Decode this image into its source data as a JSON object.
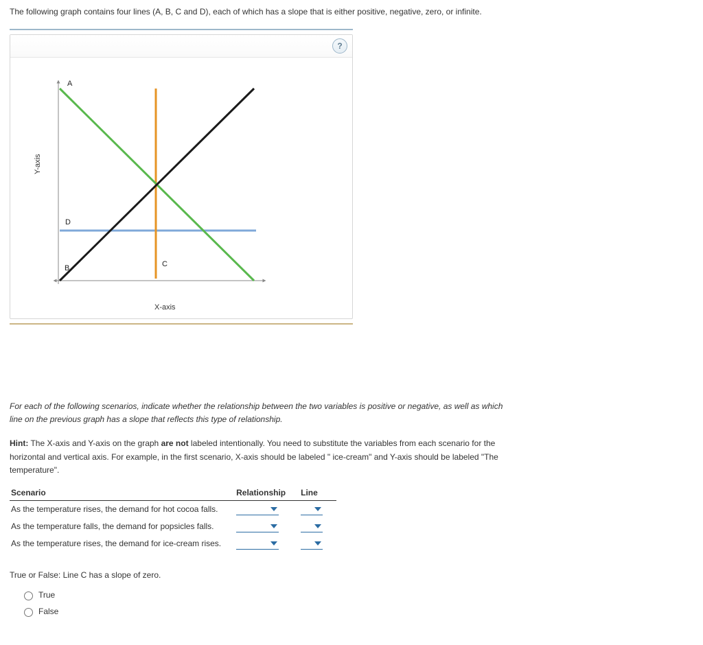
{
  "intro": "The following graph contains four lines (A, B, C and D), each of which has a slope that is either positive, negative, zero, or infinite.",
  "help_glyph": "?",
  "chart": {
    "ylabel": "Y-axis",
    "xlabel": "X-axis",
    "labels": {
      "A": "A",
      "B": "B",
      "C": "C",
      "D": "D"
    }
  },
  "chart_data": {
    "type": "line",
    "title": "",
    "xlabel": "X-axis",
    "ylabel": "Y-axis",
    "xlim": [
      0,
      10
    ],
    "ylim": [
      0,
      10
    ],
    "series": [
      {
        "name": "A",
        "slope": "negative",
        "color": "#59b84d",
        "points": [
          [
            0,
            10
          ],
          [
            10,
            0
          ]
        ]
      },
      {
        "name": "B",
        "slope": "positive",
        "color": "#1a1a1a",
        "points": [
          [
            0,
            0
          ],
          [
            10,
            10
          ]
        ]
      },
      {
        "name": "C",
        "slope": "infinite",
        "color": "#e69425",
        "points": [
          [
            5,
            0
          ],
          [
            5,
            10
          ]
        ]
      },
      {
        "name": "D",
        "slope": "zero",
        "color": "#7fa8d9",
        "points": [
          [
            0,
            3
          ],
          [
            10,
            3
          ]
        ]
      }
    ]
  },
  "prompt_italic": "For each of the following scenarios, indicate whether the relationship between the two variables is positive or negative, as well as which line on the previous graph has a slope that reflects this type of relationship.",
  "hint_label": "Hint:",
  "hint_text_1": " The X-axis and Y-axis on the graph ",
  "hint_bold": "are not",
  "hint_text_2": " labeled intentionally. You need to substitute the variables from each scenario for the horizontal and vertical axis. For example, in the first scenario, X-axis should be labeled \" ice-cream\" and Y-axis should be labeled \"The temperature\".",
  "table": {
    "headers": {
      "scenario": "Scenario",
      "relationship": "Relationship",
      "line": "Line"
    },
    "rows": [
      {
        "scenario": "As the temperature rises, the demand for hot cocoa falls."
      },
      {
        "scenario": "As the temperature falls, the demand for popsicles falls."
      },
      {
        "scenario": "As the temperature rises, the demand for ice-cream rises."
      }
    ]
  },
  "tf_question": "True or False: Line C has a slope of zero.",
  "true_label": "True",
  "false_label": "False"
}
